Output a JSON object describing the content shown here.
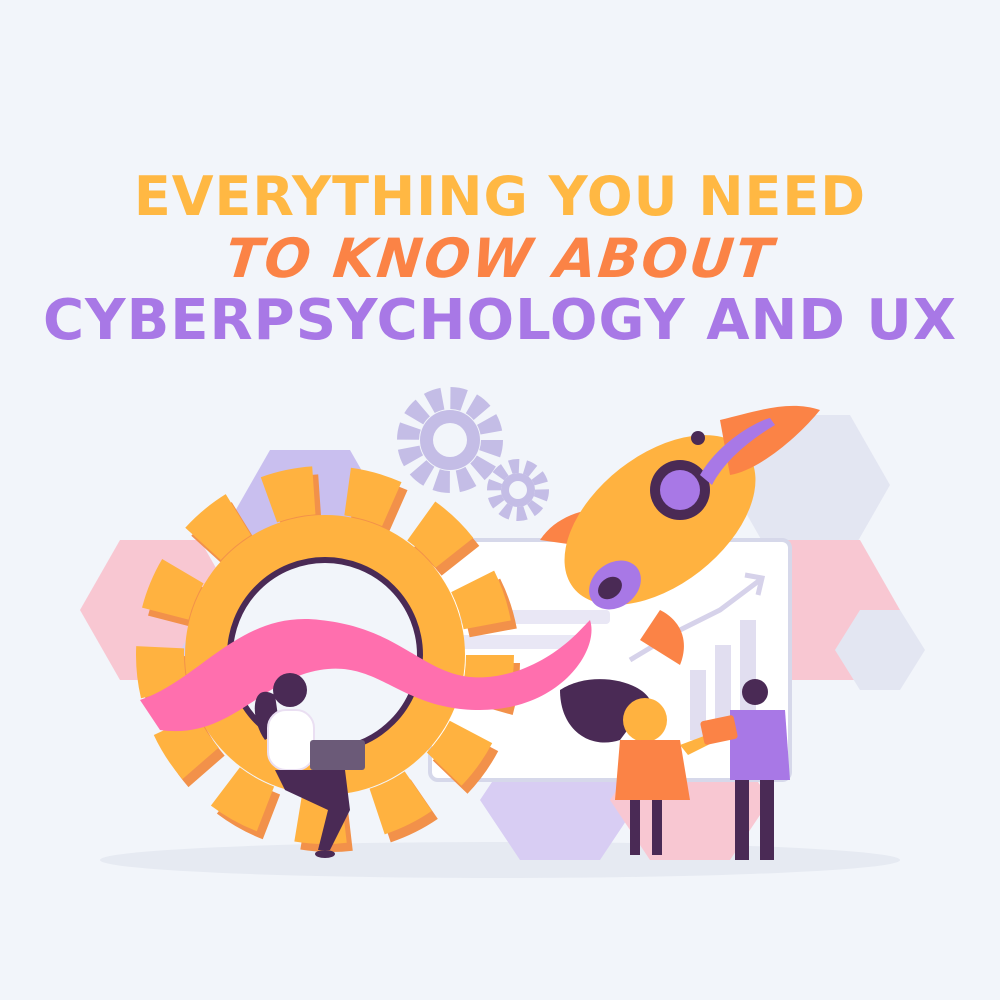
{
  "title": {
    "line1": "EVERYTHING YOU NEED",
    "line2": "TO KNOW ABOUT",
    "line3": "CYBERPSYCHOLOGY AND UX"
  },
  "colors": {
    "background": "#f2f5fa",
    "line1": "#ffb843",
    "line2": "#fb8346",
    "line3": "#a878e6",
    "gear": "#ffb240",
    "gear_shadow": "#f2914a",
    "dark": "#4a2a55",
    "pink": "#ff6fae",
    "lilac": "#b6a8e6",
    "light_pink": "#f8c7d2"
  },
  "illustration": {
    "elements": [
      "large-gear",
      "small-gears",
      "rocket",
      "dashboard-chart",
      "woman-with-laptop",
      "woman-with-tablet-user",
      "man-with-tablet",
      "hexagon-shapes",
      "pink-ribbon"
    ]
  }
}
